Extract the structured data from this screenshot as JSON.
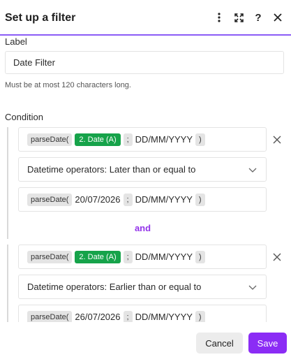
{
  "dialog": {
    "title": "Set up a filter",
    "icons": [
      "more-vertical-icon",
      "expand-icon",
      "help-icon",
      "close-icon"
    ],
    "help_glyph": "?"
  },
  "label_section": {
    "label": "Label",
    "value": "Date Filter",
    "hint": "Must be at most 120 characters long."
  },
  "condition": {
    "label": "Condition",
    "joiner": "and",
    "rules": [
      {
        "left": {
          "fn": "parseDate(",
          "var": "2. Date (A)",
          "sep": ";",
          "fmt": "DD/MM/YYYY",
          "close": ")"
        },
        "operator": "Datetime operators: Later than or equal to",
        "right": {
          "fn": "parseDate(",
          "value": "20/07/2026",
          "sep": ";",
          "fmt": "DD/MM/YYYY",
          "close": ")"
        }
      },
      {
        "left": {
          "fn": "parseDate(",
          "var": "2. Date (A)",
          "sep": ";",
          "fmt": "DD/MM/YYYY",
          "close": ")"
        },
        "operator": "Datetime operators: Earlier than or equal to",
        "right": {
          "fn": "parseDate(",
          "value": "26/07/2026",
          "sep": ";",
          "fmt": "DD/MM/YYYY",
          "close": ")"
        }
      }
    ]
  },
  "footer": {
    "cancel": "Cancel",
    "save": "Save"
  },
  "colors": {
    "accent": "#8b2cf5",
    "variable_chip": "#16a34a",
    "joiner": "#9333ea"
  }
}
